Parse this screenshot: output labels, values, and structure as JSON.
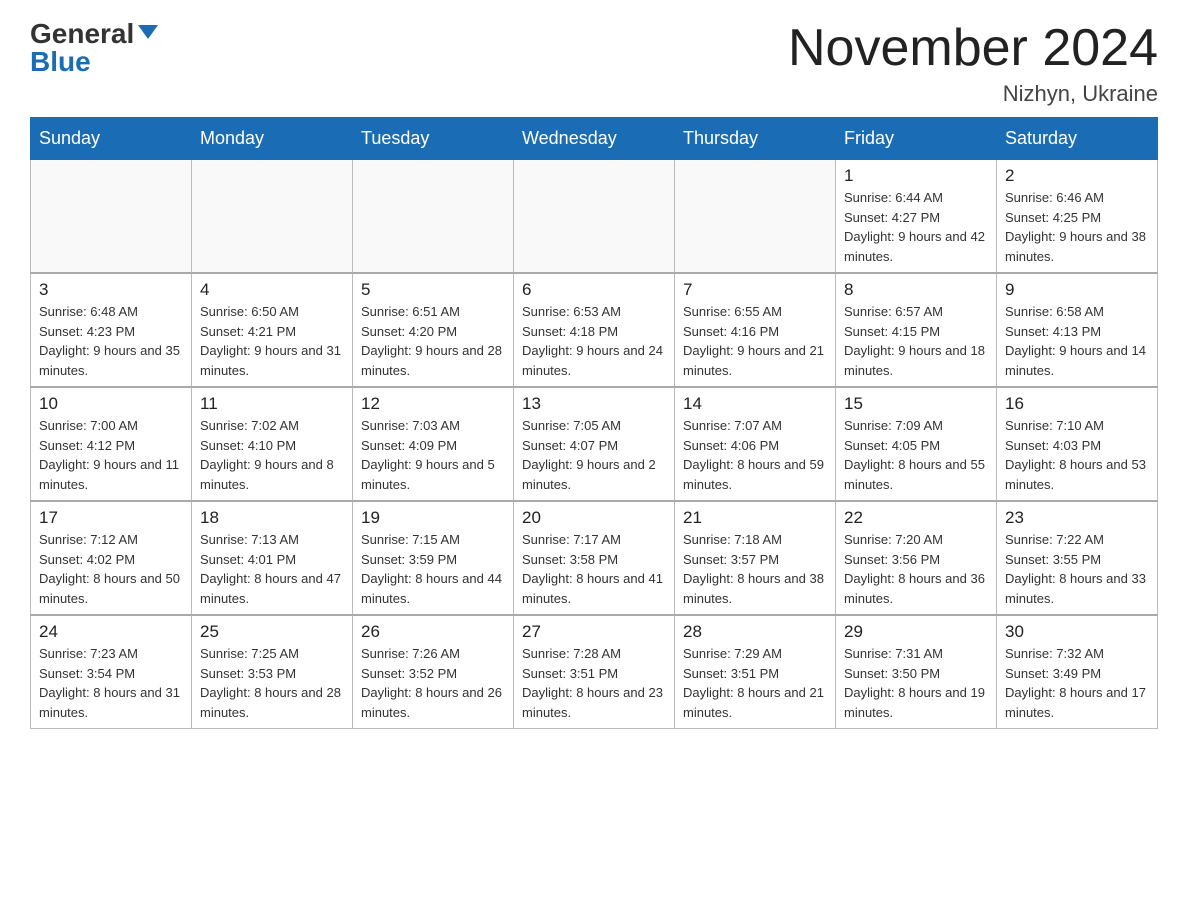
{
  "header": {
    "logo_general": "General",
    "logo_blue": "Blue",
    "month_title": "November 2024",
    "location": "Nizhyn, Ukraine"
  },
  "days_of_week": [
    "Sunday",
    "Monday",
    "Tuesday",
    "Wednesday",
    "Thursday",
    "Friday",
    "Saturday"
  ],
  "weeks": [
    {
      "days": [
        {
          "num": "",
          "info": ""
        },
        {
          "num": "",
          "info": ""
        },
        {
          "num": "",
          "info": ""
        },
        {
          "num": "",
          "info": ""
        },
        {
          "num": "",
          "info": ""
        },
        {
          "num": "1",
          "info": "Sunrise: 6:44 AM\nSunset: 4:27 PM\nDaylight: 9 hours and 42 minutes."
        },
        {
          "num": "2",
          "info": "Sunrise: 6:46 AM\nSunset: 4:25 PM\nDaylight: 9 hours and 38 minutes."
        }
      ]
    },
    {
      "days": [
        {
          "num": "3",
          "info": "Sunrise: 6:48 AM\nSunset: 4:23 PM\nDaylight: 9 hours and 35 minutes."
        },
        {
          "num": "4",
          "info": "Sunrise: 6:50 AM\nSunset: 4:21 PM\nDaylight: 9 hours and 31 minutes."
        },
        {
          "num": "5",
          "info": "Sunrise: 6:51 AM\nSunset: 4:20 PM\nDaylight: 9 hours and 28 minutes."
        },
        {
          "num": "6",
          "info": "Sunrise: 6:53 AM\nSunset: 4:18 PM\nDaylight: 9 hours and 24 minutes."
        },
        {
          "num": "7",
          "info": "Sunrise: 6:55 AM\nSunset: 4:16 PM\nDaylight: 9 hours and 21 minutes."
        },
        {
          "num": "8",
          "info": "Sunrise: 6:57 AM\nSunset: 4:15 PM\nDaylight: 9 hours and 18 minutes."
        },
        {
          "num": "9",
          "info": "Sunrise: 6:58 AM\nSunset: 4:13 PM\nDaylight: 9 hours and 14 minutes."
        }
      ]
    },
    {
      "days": [
        {
          "num": "10",
          "info": "Sunrise: 7:00 AM\nSunset: 4:12 PM\nDaylight: 9 hours and 11 minutes."
        },
        {
          "num": "11",
          "info": "Sunrise: 7:02 AM\nSunset: 4:10 PM\nDaylight: 9 hours and 8 minutes."
        },
        {
          "num": "12",
          "info": "Sunrise: 7:03 AM\nSunset: 4:09 PM\nDaylight: 9 hours and 5 minutes."
        },
        {
          "num": "13",
          "info": "Sunrise: 7:05 AM\nSunset: 4:07 PM\nDaylight: 9 hours and 2 minutes."
        },
        {
          "num": "14",
          "info": "Sunrise: 7:07 AM\nSunset: 4:06 PM\nDaylight: 8 hours and 59 minutes."
        },
        {
          "num": "15",
          "info": "Sunrise: 7:09 AM\nSunset: 4:05 PM\nDaylight: 8 hours and 55 minutes."
        },
        {
          "num": "16",
          "info": "Sunrise: 7:10 AM\nSunset: 4:03 PM\nDaylight: 8 hours and 53 minutes."
        }
      ]
    },
    {
      "days": [
        {
          "num": "17",
          "info": "Sunrise: 7:12 AM\nSunset: 4:02 PM\nDaylight: 8 hours and 50 minutes."
        },
        {
          "num": "18",
          "info": "Sunrise: 7:13 AM\nSunset: 4:01 PM\nDaylight: 8 hours and 47 minutes."
        },
        {
          "num": "19",
          "info": "Sunrise: 7:15 AM\nSunset: 3:59 PM\nDaylight: 8 hours and 44 minutes."
        },
        {
          "num": "20",
          "info": "Sunrise: 7:17 AM\nSunset: 3:58 PM\nDaylight: 8 hours and 41 minutes."
        },
        {
          "num": "21",
          "info": "Sunrise: 7:18 AM\nSunset: 3:57 PM\nDaylight: 8 hours and 38 minutes."
        },
        {
          "num": "22",
          "info": "Sunrise: 7:20 AM\nSunset: 3:56 PM\nDaylight: 8 hours and 36 minutes."
        },
        {
          "num": "23",
          "info": "Sunrise: 7:22 AM\nSunset: 3:55 PM\nDaylight: 8 hours and 33 minutes."
        }
      ]
    },
    {
      "days": [
        {
          "num": "24",
          "info": "Sunrise: 7:23 AM\nSunset: 3:54 PM\nDaylight: 8 hours and 31 minutes."
        },
        {
          "num": "25",
          "info": "Sunrise: 7:25 AM\nSunset: 3:53 PM\nDaylight: 8 hours and 28 minutes."
        },
        {
          "num": "26",
          "info": "Sunrise: 7:26 AM\nSunset: 3:52 PM\nDaylight: 8 hours and 26 minutes."
        },
        {
          "num": "27",
          "info": "Sunrise: 7:28 AM\nSunset: 3:51 PM\nDaylight: 8 hours and 23 minutes."
        },
        {
          "num": "28",
          "info": "Sunrise: 7:29 AM\nSunset: 3:51 PM\nDaylight: 8 hours and 21 minutes."
        },
        {
          "num": "29",
          "info": "Sunrise: 7:31 AM\nSunset: 3:50 PM\nDaylight: 8 hours and 19 minutes."
        },
        {
          "num": "30",
          "info": "Sunrise: 7:32 AM\nSunset: 3:49 PM\nDaylight: 8 hours and 17 minutes."
        }
      ]
    }
  ]
}
